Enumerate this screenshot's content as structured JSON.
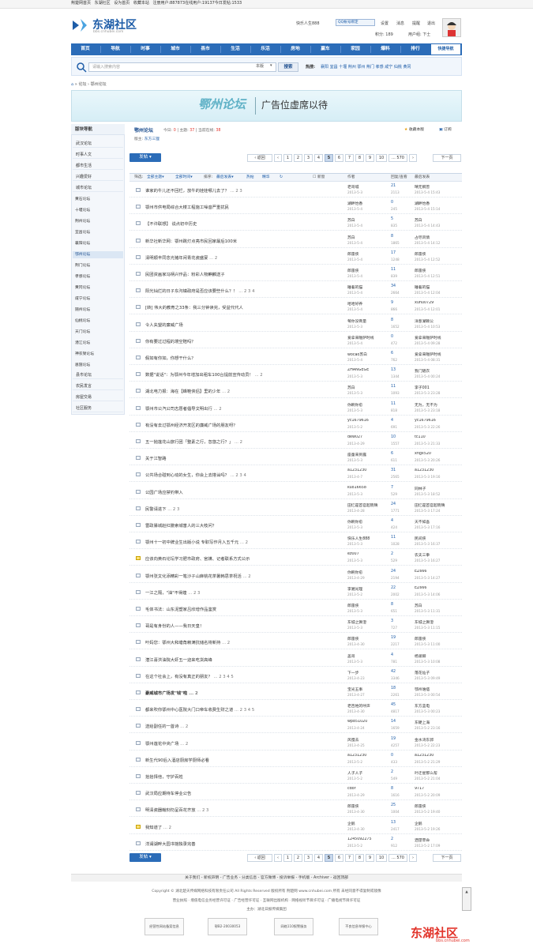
{
  "topbar": {
    "items": [
      "荆楚网首页",
      "东湖社区",
      "设为首页",
      "收藏本站",
      "注册用户:887873在线用户:19137今日发帖:1533"
    ]
  },
  "logo": {
    "name": "东湖社区",
    "domain": "bbs.cnhubei.com"
  },
  "user": {
    "name": "快乐人生888",
    "qq": "QQ帐号绑定",
    "links": [
      "设置",
      "消息",
      "提醒",
      "退出"
    ],
    "points": "积分: 189",
    "group": "用户组: 下士"
  },
  "nav": [
    "首页",
    "导航",
    "时事",
    "城市",
    "县市",
    "生活",
    "乐活",
    "房地",
    "赢车",
    "家园",
    "爆料",
    "排行"
  ],
  "nav_right": "快捷导航",
  "search": {
    "placeholder": "请输入搜索内容",
    "scope": "本版",
    "button": "搜索",
    "hot_label": "热搜:",
    "hot": [
      "襄阳",
      "宜昌",
      "十堰",
      "荆州",
      "鄂州",
      "荆门",
      "孝感",
      "咸宁",
      "仙桃",
      "黄冈"
    ]
  },
  "breadcrumb": [
    "论坛",
    "鄂州论坛"
  ],
  "banner": {
    "name": "鄂州论坛",
    "ad": "广告位虚席以待"
  },
  "sidebar": {
    "title": "版块导航",
    "cats": [
      "武汉论坛",
      "时事人文",
      "都市生活",
      "兴趣爱好",
      "城市论坛"
    ],
    "subs": [
      "黄石论坛",
      "十堰论坛",
      "荆州论坛",
      "宜昌论坛",
      "襄阳论坛",
      "鄂州论坛",
      "荆门论坛",
      "孝感论坛",
      "黄冈论坛",
      "咸宁论坛",
      "随州论坛",
      "仙桃论坛",
      "天门论坛",
      "潜江论坛",
      "神农架论坛",
      "恩施论坛"
    ],
    "cats2": [
      "县市论坛",
      "农民发言",
      "房屋交易",
      "社区服务"
    ]
  },
  "forum": {
    "name": "鄂州论坛",
    "today_label": "今日:",
    "today": "0",
    "topics_label": "主题:",
    "topics": "37",
    "rank_label": "当前在线:",
    "rank": "38",
    "mod_label": "版主:",
    "mod": "东方三狸",
    "fav": "收藏本版",
    "sub": "订阅"
  },
  "post_btn": "发帖",
  "pager": {
    "back": "返回",
    "pages": [
      "1",
      "2",
      "3",
      "4",
      "5",
      "6",
      "7",
      "8",
      "9",
      "10"
    ],
    "dots": "... 570",
    "next": "下一页",
    "current": "5"
  },
  "thead": {
    "filter": "筛选:",
    "all": "全部主题",
    "time": "全部时间",
    "sort": "排序:",
    "latest": "最后发表",
    "hot": "热帖",
    "digest": "精华",
    "newwin": "新窗",
    "author": "作者",
    "reply": "回复/查看",
    "last": "最后发表"
  },
  "rows": [
    {
      "t": "谁家的牛儿还不回栏，放牛的娃娃哪儿去了？",
      "pg": "... 2 3",
      "ua": "老哥城",
      "ud": "2013-5-3",
      "ra": "21",
      "rv": "2113",
      "la": "晴无纲曾",
      "ld": "2013-5-4 15:43"
    },
    {
      "t": "鄂州市供电局综合大楼工程施工噪音严重扰民",
      "pg": "",
      "ua": "湖畔怡香",
      "ud": "2013-5-4",
      "ra": "0",
      "rv": "245",
      "la": "湖畔怡香",
      "ld": "2013-5-4 15:14"
    },
    {
      "t": "【不许联想】 说点初中历史",
      "pg": "",
      "ua": "苏白",
      "ud": "2013-5-4",
      "ra": "5",
      "rv": "835",
      "la": "苏白",
      "ld": "2013-5-4 14:43"
    },
    {
      "t": "新华社新华网：鄂州跳灯点亮市民回家最后100米",
      "pg": "",
      "ua": "苏白",
      "ud": "2013-5-4",
      "ra": "8",
      "rv": "1865",
      "la": "占尽风情",
      "ld": "2013-5-4 14:12"
    },
    {
      "t": "清明顺丰同念光猪年闲青花瓷盛宴",
      "pg": "... 2",
      "ua": "郎雷侠",
      "ud": "2013-5-4",
      "ra": "17",
      "rv": "1248",
      "la": "郎雷侠",
      "ld": "2013-5-4 12:52"
    },
    {
      "t": "民团资画家冯柄兴作品：粉彩人物麒麟送子",
      "pg": "",
      "ua": "郎雷侠",
      "ud": "2013-5-4",
      "ra": "11",
      "rv": "839",
      "la": "郎雷侠",
      "ld": "2013-5-4 12:51"
    },
    {
      "t": "阳光灿烂的日子东沟镇政府是否应该要些什么？！",
      "pg": "... 2 3 4",
      "ua": "睡着的猫",
      "ud": "2013-5-4",
      "ra": "34",
      "rv": "2664",
      "la": "睡着的猫",
      "ld": "2013-5-4 12:04"
    },
    {
      "t": "[转] 伟大的教育之33条：我三分钟读完，受益代代人",
      "pg": "",
      "ua": "哈哈好养",
      "ud": "2013-5-4",
      "ra": "9",
      "rv": "866",
      "la": "xuhu0729",
      "ld": "2013-5-4 12:01"
    },
    {
      "t": "令人失望的廉威广场",
      "pg": "",
      "ua": "莓你没商量",
      "ud": "2013-5-3",
      "ra": "8",
      "rv": "1652",
      "la": "洋葱湖赖公",
      "ld": "2013-5-4 10:53"
    },
    {
      "t": "你有要过过程的境空赔吗？",
      "pg": "",
      "ua": "爱拿来喔萨时线",
      "ud": "2013-5-4",
      "ra": "0",
      "rv": "472",
      "la": "爱拿来喔萨时线",
      "ld": "2013-5-4 09:28"
    },
    {
      "t": "假如有你如，你想干什么？",
      "pg": "",
      "ua": "wocao苏白",
      "ud": "2013-5-4",
      "ra": "6",
      "rv": "762",
      "la": "爱拿来喔萨时线",
      "ld": "2013-5-4 08:31"
    },
    {
      "t": "数据\"说话\"：为鄂州今年增加出租车100台提前宣传动员！",
      "pg": "... 2",
      "ua": "ZHANGEGE",
      "ud": "2013-5-3",
      "ra": "13",
      "rv": "1344",
      "la": "我门随衣",
      "ld": "2013-5-4 00:24"
    },
    {
      "t": "湖北电力报：海在【蜂鞋侠侣】里的少年",
      "pg": "... 2",
      "ua": "苏白",
      "ud": "2013-5-3",
      "ra": "11",
      "rv": "1093",
      "la": "李子001",
      "ld": "2013-5-3 23:28"
    },
    {
      "t": "鄂州市公汽公司志愿者倡导文明出行",
      "pg": "... 2",
      "ua": "你刷你愈",
      "ud": "2013-5-3",
      "ra": "11",
      "rv": "818",
      "la": "无为，无不为",
      "ld": "2013-5-3 23:18"
    },
    {
      "t": "有没有去过鄂州经济开发区的廉威广场的朋友呀？",
      "pg": "",
      "ua": "yc1679616",
      "ud": "2013-5-2",
      "ra": "4",
      "rv": "691",
      "la": "yc1679616",
      "ld": "2013-5-3 22:26"
    },
    {
      "t": "五一抛莲花山旅行团「整素之行，忽悠之行？」",
      "pg": "... 2",
      "ua": "dew027",
      "ud": "2013-4-29",
      "ra": "10",
      "rv": "1557",
      "la": "tc110",
      "ld": "2013-5-3 21:33"
    },
    {
      "t": "关于江智路",
      "pg": "",
      "ua": "座童来到露",
      "ud": "2013-5-3",
      "ra": "6",
      "rv": "611",
      "la": "xhgx520",
      "ld": "2013-5-3 20:26"
    },
    {
      "t": "公共场合碰到心动的女生，你会上去搭讪吗？",
      "pg": "... 2 3 4",
      "ua": "a1231230",
      "ud": "2013-4-7",
      "ra": "31",
      "rv": "2565",
      "la": "a1231230",
      "ld": "2013-5-3 19:16"
    },
    {
      "t": "公园广场应禁钓带入",
      "pg": "",
      "ua": "kuo16658",
      "ud": "2013-5-3",
      "ra": "7",
      "rv": "529",
      "la": "同林子",
      "ld": "2013-5-3 18:52"
    },
    {
      "t": "民警请进下",
      "pg": "... 2 3",
      "ua": "田忆是首官超晓晴",
      "ud": "2013-4-28",
      "ra": "24",
      "rv": "1771",
      "la": "田忆是首官超晓晴",
      "ld": "2013-5-3 17:24"
    },
    {
      "t": "雷政暴城赵红撒索城害人的三大枝问？",
      "pg": "",
      "ua": "你刷你愈",
      "ud": "2013-5-3",
      "ra": "4",
      "rv": "424",
      "la": "天不如吾",
      "ld": "2013-5-3 17:16"
    },
    {
      "t": "鄂州十一初中牌业生出版小说 专职写作月入五千元",
      "pg": "... 2",
      "ua": "快乐人生888",
      "ud": "2013-5-3",
      "ra": "11",
      "rv": "1028",
      "la": "民间侠",
      "ld": "2013-5-3 16:37"
    },
    {
      "t": "应该向黄石论坛学习肥市政府、官媒、记者联系方式公示",
      "pg": "",
      "ua": "ez007",
      "ud": "2013-5-3",
      "ra": "2",
      "rv": "529",
      "la": "农夫三拳",
      "ld": "2013-5-3 16:27",
      "lock": true
    },
    {
      "t": "鄂州张文化添精彩一笔沙子山麻桃花茶暑韩思茶祝活",
      "pg": "... 2",
      "ua": "你刷你愈",
      "ud": "2013-4-29",
      "ra": "24",
      "rv": "2194",
      "la": "EZ666",
      "ld": "2013-5-3 14:27"
    },
    {
      "t": "一江之隔，\"油\"不得煌",
      "pg": "... 2 3",
      "ua": "李湘光理",
      "ud": "2013-5-2",
      "ra": "22",
      "rv": "2002",
      "la": "EZ666",
      "ld": "2013-5-3 14:06"
    },
    {
      "t": "毛体书法：山东泥塑家吕欣增作品鉴赏",
      "pg": "",
      "ua": "郎雷侠",
      "ud": "2013-5-3",
      "ra": "8",
      "rv": "651",
      "la": "苏白",
      "ld": "2013-5-3 11:31"
    },
    {
      "t": "哥是有身份的人——我日天皇！",
      "pg": "",
      "ua": "东城之狮澄",
      "ud": "2013-5-3",
      "ra": "3",
      "rv": "727",
      "la": "东城之狮澄",
      "ld": "2013-5-3 11:15"
    },
    {
      "t": "叶妈您：鄂州大和塘角赖满抗储名将新持",
      "pg": "... 2",
      "ua": "郎雷侠",
      "ud": "2013-4-30",
      "ra": "19",
      "rv": "2217",
      "la": "郎雷侠",
      "ld": "2013-5-3 11:00"
    },
    {
      "t": "潜江喜洪油院大虾五一迎来吃货高峰",
      "pg": "",
      "ua": "盖哥",
      "ud": "2013-5-3",
      "ra": "4",
      "rv": "781",
      "la": "杨濯卿",
      "ld": "2013-5-3 10:08"
    },
    {
      "t": "在这个社会上，有没有真正的朋友？",
      "pg": "... 2 3 4 5",
      "ua": "下一步",
      "ud": "2013-4-23",
      "ra": "42",
      "rv": "3346",
      "la": "落花仙子",
      "ld": "2013-5-3 09:49"
    },
    {
      "t": "豪威城市广场发\"钱\"啦",
      "pg": "... 2",
      "ua": "宝光五事",
      "ud": "2013-4-27",
      "ra": "18",
      "rv": "2261",
      "la": "鄂州谁痞",
      "ld": "2013-5-3 00:54",
      "bold": true
    },
    {
      "t": "都来吹你鄂州中心医院大门口帝车收费生财之道",
      "pg": "... 2 3 4 5",
      "ua": "老百姓的呼声",
      "ud": "2013-4-30",
      "ra": "45",
      "rv": "4817",
      "la": "东方蓝电",
      "ld": "2013-5-3 00:23"
    },
    {
      "t": "送给副任的一首诗",
      "pg": "... 2",
      "ua": "wp851020",
      "ud": "2013-4-24",
      "ra": "14",
      "rv": "1659",
      "la": "东硬上海",
      "ld": "2013-5-2 23:16"
    },
    {
      "t": "鄂州莲花中央广场",
      "pg": "... 2",
      "ua": "风慢去",
      "ud": "2013-4-25",
      "ra": "19",
      "rv": "4257",
      "la": "金水湾东郭",
      "ld": "2013-5-2 22:23"
    },
    {
      "t": "新生代90后入酒店厨房学厨师必看",
      "pg": "",
      "ua": "a1231230",
      "ud": "2013-5-2",
      "ra": "0",
      "rv": "433",
      "la": "a1231230",
      "ld": "2013-5-2 21:29"
    },
    {
      "t": "拾拾择他，守护百姓",
      "pg": "",
      "ua": "人子人子",
      "ud": "2013-5-2",
      "ra": "2",
      "rv": "549",
      "la": "叶迁星那么帮",
      "ld": "2013-5-2 21:04"
    },
    {
      "t": "武汉局应期待车停业公告",
      "pg": "",
      "ua": "cdor",
      "ud": "2013-4-29",
      "ra": "8",
      "rv": "1616",
      "la": "9717",
      "ld": "2013-5-2 20:09"
    },
    {
      "t": "明清瓷器翰刻勿呈百花齐放",
      "pg": "... 2 3",
      "ua": "郎雷侠",
      "ud": "2013-4-30",
      "ra": "25",
      "rv": "1004",
      "la": "郎雷侠",
      "ld": "2013-5-2 19:40"
    },
    {
      "t": "我知道了",
      "pg": "... 2",
      "ua": "企鹅",
      "ud": "2013-4-30",
      "ra": "13",
      "rv": "2417",
      "la": "企鹅",
      "ld": "2013-5-2 19:26",
      "lock": true
    },
    {
      "t": "洋澜湖畔大园书馆独录完善",
      "pg": "",
      "ua": "1245092275",
      "ud": "2013-5-2",
      "ra": "2",
      "rv": "912",
      "la": "洒望苹命",
      "ld": "2013-5-2 17:09"
    }
  ],
  "footer": {
    "links": "关于我们 - 新权声明 - 广告业务 - 分类信息 - 官方微博 - 投诉举报 - 手机版 - Archiver - 返回顶部",
    "copyright": "Copyright © 湖北楚天传媒网络科技有限责任公司 All Rights Reserved 版权所有 荆楚网 www.cnhubei.com 所有 未经同意不得复制或镜像",
    "license": "营业执照 · 增值电信业务经营许可证 · 广告经营许可证 · 互联网出版机构 · 网络视听节目许可证 · 广播电视节目许可证",
    "host": "主办：湖北日报传媒集团",
    "badges": [
      "经营性网站备案信息",
      "鄂B2-20030053",
      "网络110报警服务",
      "不良信息举报中心"
    ],
    "watermark": "东湖社区",
    "watermark_url": "bbs.cnhubei.com"
  },
  "colors": {
    "nav": "#2b6cb8",
    "accent": "#1e5da8",
    "brand_red": "#e2342b"
  }
}
